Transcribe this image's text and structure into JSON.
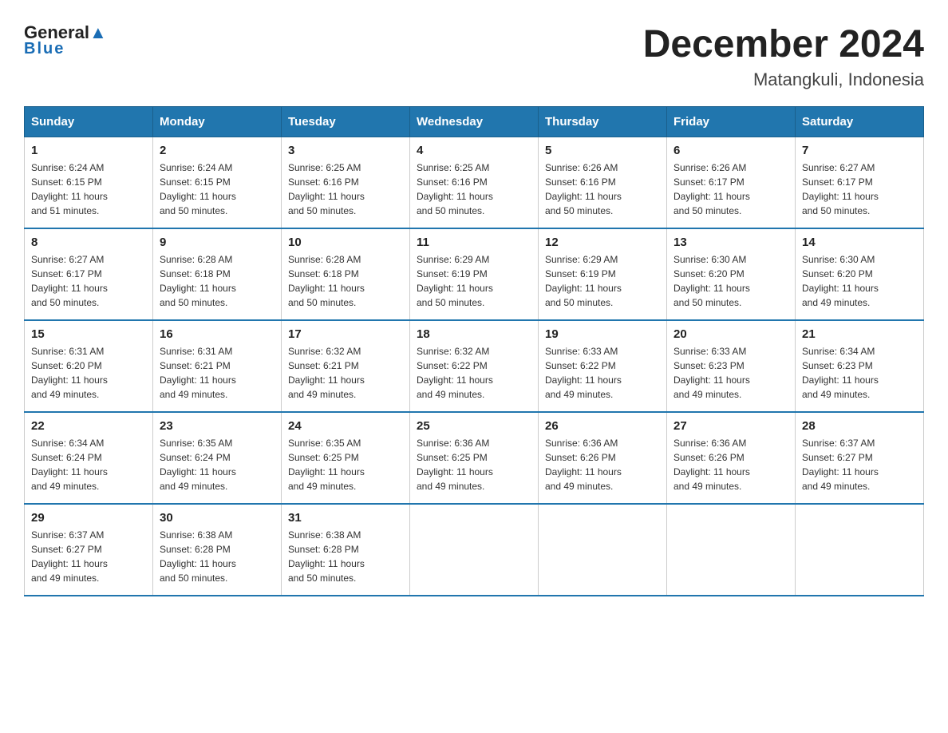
{
  "header": {
    "logo": {
      "line1": "General",
      "line2": "Blue"
    },
    "title": "December 2024",
    "subtitle": "Matangkuli, Indonesia"
  },
  "weekdays": [
    "Sunday",
    "Monday",
    "Tuesday",
    "Wednesday",
    "Thursday",
    "Friday",
    "Saturday"
  ],
  "weeks": [
    [
      {
        "day": "1",
        "sunrise": "6:24 AM",
        "sunset": "6:15 PM",
        "daylight": "11 hours and 51 minutes."
      },
      {
        "day": "2",
        "sunrise": "6:24 AM",
        "sunset": "6:15 PM",
        "daylight": "11 hours and 50 minutes."
      },
      {
        "day": "3",
        "sunrise": "6:25 AM",
        "sunset": "6:16 PM",
        "daylight": "11 hours and 50 minutes."
      },
      {
        "day": "4",
        "sunrise": "6:25 AM",
        "sunset": "6:16 PM",
        "daylight": "11 hours and 50 minutes."
      },
      {
        "day": "5",
        "sunrise": "6:26 AM",
        "sunset": "6:16 PM",
        "daylight": "11 hours and 50 minutes."
      },
      {
        "day": "6",
        "sunrise": "6:26 AM",
        "sunset": "6:17 PM",
        "daylight": "11 hours and 50 minutes."
      },
      {
        "day": "7",
        "sunrise": "6:27 AM",
        "sunset": "6:17 PM",
        "daylight": "11 hours and 50 minutes."
      }
    ],
    [
      {
        "day": "8",
        "sunrise": "6:27 AM",
        "sunset": "6:17 PM",
        "daylight": "11 hours and 50 minutes."
      },
      {
        "day": "9",
        "sunrise": "6:28 AM",
        "sunset": "6:18 PM",
        "daylight": "11 hours and 50 minutes."
      },
      {
        "day": "10",
        "sunrise": "6:28 AM",
        "sunset": "6:18 PM",
        "daylight": "11 hours and 50 minutes."
      },
      {
        "day": "11",
        "sunrise": "6:29 AM",
        "sunset": "6:19 PM",
        "daylight": "11 hours and 50 minutes."
      },
      {
        "day": "12",
        "sunrise": "6:29 AM",
        "sunset": "6:19 PM",
        "daylight": "11 hours and 50 minutes."
      },
      {
        "day": "13",
        "sunrise": "6:30 AM",
        "sunset": "6:20 PM",
        "daylight": "11 hours and 50 minutes."
      },
      {
        "day": "14",
        "sunrise": "6:30 AM",
        "sunset": "6:20 PM",
        "daylight": "11 hours and 49 minutes."
      }
    ],
    [
      {
        "day": "15",
        "sunrise": "6:31 AM",
        "sunset": "6:20 PM",
        "daylight": "11 hours and 49 minutes."
      },
      {
        "day": "16",
        "sunrise": "6:31 AM",
        "sunset": "6:21 PM",
        "daylight": "11 hours and 49 minutes."
      },
      {
        "day": "17",
        "sunrise": "6:32 AM",
        "sunset": "6:21 PM",
        "daylight": "11 hours and 49 minutes."
      },
      {
        "day": "18",
        "sunrise": "6:32 AM",
        "sunset": "6:22 PM",
        "daylight": "11 hours and 49 minutes."
      },
      {
        "day": "19",
        "sunrise": "6:33 AM",
        "sunset": "6:22 PM",
        "daylight": "11 hours and 49 minutes."
      },
      {
        "day": "20",
        "sunrise": "6:33 AM",
        "sunset": "6:23 PM",
        "daylight": "11 hours and 49 minutes."
      },
      {
        "day": "21",
        "sunrise": "6:34 AM",
        "sunset": "6:23 PM",
        "daylight": "11 hours and 49 minutes."
      }
    ],
    [
      {
        "day": "22",
        "sunrise": "6:34 AM",
        "sunset": "6:24 PM",
        "daylight": "11 hours and 49 minutes."
      },
      {
        "day": "23",
        "sunrise": "6:35 AM",
        "sunset": "6:24 PM",
        "daylight": "11 hours and 49 minutes."
      },
      {
        "day": "24",
        "sunrise": "6:35 AM",
        "sunset": "6:25 PM",
        "daylight": "11 hours and 49 minutes."
      },
      {
        "day": "25",
        "sunrise": "6:36 AM",
        "sunset": "6:25 PM",
        "daylight": "11 hours and 49 minutes."
      },
      {
        "day": "26",
        "sunrise": "6:36 AM",
        "sunset": "6:26 PM",
        "daylight": "11 hours and 49 minutes."
      },
      {
        "day": "27",
        "sunrise": "6:36 AM",
        "sunset": "6:26 PM",
        "daylight": "11 hours and 49 minutes."
      },
      {
        "day": "28",
        "sunrise": "6:37 AM",
        "sunset": "6:27 PM",
        "daylight": "11 hours and 49 minutes."
      }
    ],
    [
      {
        "day": "29",
        "sunrise": "6:37 AM",
        "sunset": "6:27 PM",
        "daylight": "11 hours and 49 minutes."
      },
      {
        "day": "30",
        "sunrise": "6:38 AM",
        "sunset": "6:28 PM",
        "daylight": "11 hours and 50 minutes."
      },
      {
        "day": "31",
        "sunrise": "6:38 AM",
        "sunset": "6:28 PM",
        "daylight": "11 hours and 50 minutes."
      },
      null,
      null,
      null,
      null
    ]
  ],
  "labels": {
    "sunrise": "Sunrise:",
    "sunset": "Sunset:",
    "daylight": "Daylight:"
  }
}
